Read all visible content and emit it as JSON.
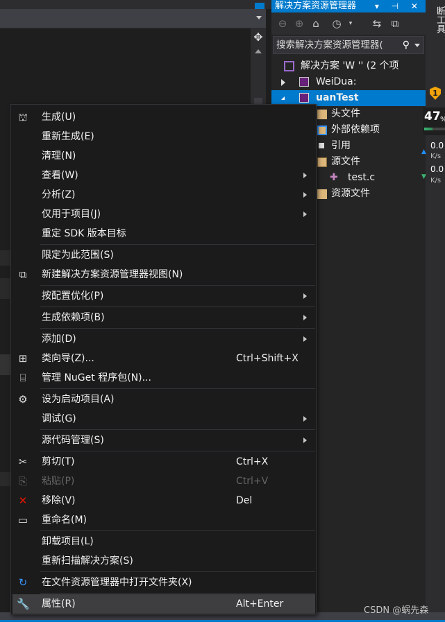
{
  "solution_explorer": {
    "title": "解决方案资源管理器",
    "title_buttons": "▾ ⊣ ✕",
    "search_placeholder": "搜索解决方案资源管理器(",
    "tree": {
      "solution": "解决方案 'W              '' (2 个项",
      "project1": "WeiDua:",
      "project2_selected": "         uanTest",
      "header_files": "头文件",
      "external_deps": "外部依赖项",
      "references": "引用",
      "source_files": "源文件",
      "test_file": "test.c",
      "resource_files": "资源文件"
    }
  },
  "tool_strip": {
    "label": "断工具",
    "shield_badge": "1",
    "cpu_percent": "47",
    "cpu_percent_sign": "%",
    "cpu_fraction": 0.4,
    "net_up_value": "0.0",
    "net_up_unit": "K/s",
    "net_down_value": "0.0",
    "net_down_unit": "K/s"
  },
  "context_menu": {
    "items": [
      {
        "label": "生成(U)",
        "icon": "build-icon"
      },
      {
        "label": "重新生成(E)"
      },
      {
        "label": "清理(N)"
      },
      {
        "label": "查看(W)",
        "submenu": true
      },
      {
        "label": "分析(Z)",
        "submenu": true
      },
      {
        "label": "仅用于项目(J)",
        "submenu": true
      },
      {
        "label": "重定 SDK 版本目标"
      },
      {
        "label": "限定为此范围(S)"
      },
      {
        "label": "新建解决方案资源管理器视图(N)",
        "icon": "new-view-icon"
      },
      {
        "label": "按配置优化(P)",
        "submenu": true
      },
      {
        "label": "生成依赖项(B)",
        "submenu": true
      },
      {
        "label": "添加(D)",
        "submenu": true
      },
      {
        "label": "类向导(Z)...",
        "shortcut": "Ctrl+Shift+X",
        "icon": "class-wizard-icon"
      },
      {
        "label": "管理 NuGet 程序包(N)...",
        "icon": "nuget-icon"
      },
      {
        "label": "设为启动项目(A)",
        "icon": "gear-icon"
      },
      {
        "label": "调试(G)",
        "submenu": true
      },
      {
        "label": "源代码管理(S)",
        "submenu": true
      },
      {
        "label": "剪切(T)",
        "shortcut": "Ctrl+X",
        "icon": "scissors-icon"
      },
      {
        "label": "粘贴(P)",
        "shortcut": "Ctrl+V",
        "icon": "paste-icon",
        "disabled": true
      },
      {
        "label": "移除(V)",
        "shortcut": "Del",
        "icon": "remove-icon"
      },
      {
        "label": "重命名(M)",
        "icon": "rename-icon"
      },
      {
        "label": "卸载项目(L)"
      },
      {
        "label": "重新扫描解决方案(S)"
      },
      {
        "label": "在文件资源管理器中打开文件夹(X)",
        "icon": "open-folder-icon"
      },
      {
        "label": "属性(R)",
        "shortcut": "Alt+Enter",
        "icon": "wrench-icon",
        "hovered": true
      }
    ]
  },
  "watermark": "CSDN @蜗先森",
  "colors": {
    "accent": "#007acc",
    "menu_bg": "#1b1b1c",
    "menu_hover": "#3e3e40",
    "disabled_text": "#656565",
    "remove_red": "#e51400",
    "open_folder_blue": "#3794ff"
  }
}
